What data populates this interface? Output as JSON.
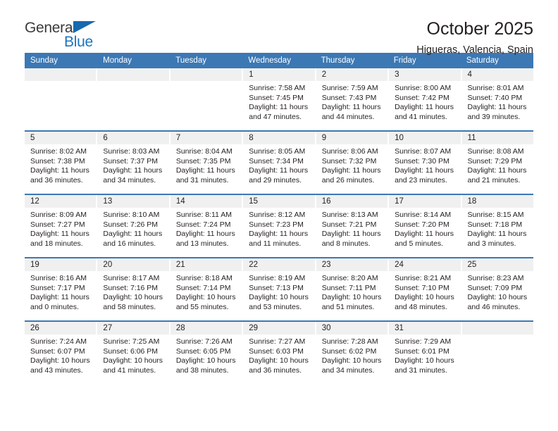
{
  "brand": {
    "name_part1": "General",
    "name_part2": "Blue",
    "triangle_icon": "triangle-icon",
    "accent_color": "#1c75bc"
  },
  "header": {
    "title": "October 2025",
    "location": "Higueras, Valencia, Spain"
  },
  "theme": {
    "header_blue": "#3c78b4",
    "daynum_band": "#f0f0f0",
    "text": "#231f20"
  },
  "calendar": {
    "weekday_headers": [
      "Sunday",
      "Monday",
      "Tuesday",
      "Wednesday",
      "Thursday",
      "Friday",
      "Saturday"
    ],
    "weeks": [
      [
        {
          "day": "",
          "lines": []
        },
        {
          "day": "",
          "lines": []
        },
        {
          "day": "",
          "lines": []
        },
        {
          "day": "1",
          "lines": [
            "Sunrise: 7:58 AM",
            "Sunset: 7:45 PM",
            "Daylight: 11 hours",
            "and 47 minutes."
          ]
        },
        {
          "day": "2",
          "lines": [
            "Sunrise: 7:59 AM",
            "Sunset: 7:43 PM",
            "Daylight: 11 hours",
            "and 44 minutes."
          ]
        },
        {
          "day": "3",
          "lines": [
            "Sunrise: 8:00 AM",
            "Sunset: 7:42 PM",
            "Daylight: 11 hours",
            "and 41 minutes."
          ]
        },
        {
          "day": "4",
          "lines": [
            "Sunrise: 8:01 AM",
            "Sunset: 7:40 PM",
            "Daylight: 11 hours",
            "and 39 minutes."
          ]
        }
      ],
      [
        {
          "day": "5",
          "lines": [
            "Sunrise: 8:02 AM",
            "Sunset: 7:38 PM",
            "Daylight: 11 hours",
            "and 36 minutes."
          ]
        },
        {
          "day": "6",
          "lines": [
            "Sunrise: 8:03 AM",
            "Sunset: 7:37 PM",
            "Daylight: 11 hours",
            "and 34 minutes."
          ]
        },
        {
          "day": "7",
          "lines": [
            "Sunrise: 8:04 AM",
            "Sunset: 7:35 PM",
            "Daylight: 11 hours",
            "and 31 minutes."
          ]
        },
        {
          "day": "8",
          "lines": [
            "Sunrise: 8:05 AM",
            "Sunset: 7:34 PM",
            "Daylight: 11 hours",
            "and 29 minutes."
          ]
        },
        {
          "day": "9",
          "lines": [
            "Sunrise: 8:06 AM",
            "Sunset: 7:32 PM",
            "Daylight: 11 hours",
            "and 26 minutes."
          ]
        },
        {
          "day": "10",
          "lines": [
            "Sunrise: 8:07 AM",
            "Sunset: 7:30 PM",
            "Daylight: 11 hours",
            "and 23 minutes."
          ]
        },
        {
          "day": "11",
          "lines": [
            "Sunrise: 8:08 AM",
            "Sunset: 7:29 PM",
            "Daylight: 11 hours",
            "and 21 minutes."
          ]
        }
      ],
      [
        {
          "day": "12",
          "lines": [
            "Sunrise: 8:09 AM",
            "Sunset: 7:27 PM",
            "Daylight: 11 hours",
            "and 18 minutes."
          ]
        },
        {
          "day": "13",
          "lines": [
            "Sunrise: 8:10 AM",
            "Sunset: 7:26 PM",
            "Daylight: 11 hours",
            "and 16 minutes."
          ]
        },
        {
          "day": "14",
          "lines": [
            "Sunrise: 8:11 AM",
            "Sunset: 7:24 PM",
            "Daylight: 11 hours",
            "and 13 minutes."
          ]
        },
        {
          "day": "15",
          "lines": [
            "Sunrise: 8:12 AM",
            "Sunset: 7:23 PM",
            "Daylight: 11 hours",
            "and 11 minutes."
          ]
        },
        {
          "day": "16",
          "lines": [
            "Sunrise: 8:13 AM",
            "Sunset: 7:21 PM",
            "Daylight: 11 hours",
            "and 8 minutes."
          ]
        },
        {
          "day": "17",
          "lines": [
            "Sunrise: 8:14 AM",
            "Sunset: 7:20 PM",
            "Daylight: 11 hours",
            "and 5 minutes."
          ]
        },
        {
          "day": "18",
          "lines": [
            "Sunrise: 8:15 AM",
            "Sunset: 7:18 PM",
            "Daylight: 11 hours",
            "and 3 minutes."
          ]
        }
      ],
      [
        {
          "day": "19",
          "lines": [
            "Sunrise: 8:16 AM",
            "Sunset: 7:17 PM",
            "Daylight: 11 hours",
            "and 0 minutes."
          ]
        },
        {
          "day": "20",
          "lines": [
            "Sunrise: 8:17 AM",
            "Sunset: 7:16 PM",
            "Daylight: 10 hours",
            "and 58 minutes."
          ]
        },
        {
          "day": "21",
          "lines": [
            "Sunrise: 8:18 AM",
            "Sunset: 7:14 PM",
            "Daylight: 10 hours",
            "and 55 minutes."
          ]
        },
        {
          "day": "22",
          "lines": [
            "Sunrise: 8:19 AM",
            "Sunset: 7:13 PM",
            "Daylight: 10 hours",
            "and 53 minutes."
          ]
        },
        {
          "day": "23",
          "lines": [
            "Sunrise: 8:20 AM",
            "Sunset: 7:11 PM",
            "Daylight: 10 hours",
            "and 51 minutes."
          ]
        },
        {
          "day": "24",
          "lines": [
            "Sunrise: 8:21 AM",
            "Sunset: 7:10 PM",
            "Daylight: 10 hours",
            "and 48 minutes."
          ]
        },
        {
          "day": "25",
          "lines": [
            "Sunrise: 8:23 AM",
            "Sunset: 7:09 PM",
            "Daylight: 10 hours",
            "and 46 minutes."
          ]
        }
      ],
      [
        {
          "day": "26",
          "lines": [
            "Sunrise: 7:24 AM",
            "Sunset: 6:07 PM",
            "Daylight: 10 hours",
            "and 43 minutes."
          ]
        },
        {
          "day": "27",
          "lines": [
            "Sunrise: 7:25 AM",
            "Sunset: 6:06 PM",
            "Daylight: 10 hours",
            "and 41 minutes."
          ]
        },
        {
          "day": "28",
          "lines": [
            "Sunrise: 7:26 AM",
            "Sunset: 6:05 PM",
            "Daylight: 10 hours",
            "and 38 minutes."
          ]
        },
        {
          "day": "29",
          "lines": [
            "Sunrise: 7:27 AM",
            "Sunset: 6:03 PM",
            "Daylight: 10 hours",
            "and 36 minutes."
          ]
        },
        {
          "day": "30",
          "lines": [
            "Sunrise: 7:28 AM",
            "Sunset: 6:02 PM",
            "Daylight: 10 hours",
            "and 34 minutes."
          ]
        },
        {
          "day": "31",
          "lines": [
            "Sunrise: 7:29 AM",
            "Sunset: 6:01 PM",
            "Daylight: 10 hours",
            "and 31 minutes."
          ]
        },
        {
          "day": "",
          "lines": []
        }
      ]
    ]
  }
}
